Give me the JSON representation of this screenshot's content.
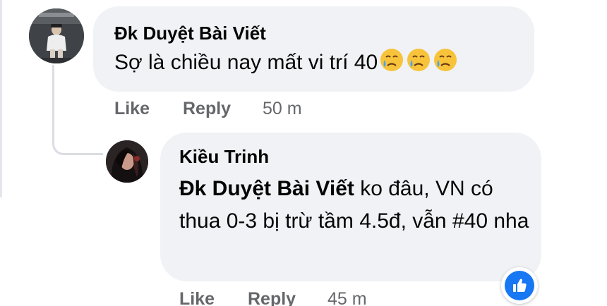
{
  "comment": {
    "author": "Đk Duyệt Bài Viết",
    "text": "Sợ là chiều nay mất vi trí 40",
    "emojis": [
      "sad-but-relieved-face",
      "sad-but-relieved-face",
      "sad-but-relieved-face"
    ],
    "actions": {
      "like": "Like",
      "reply": "Reply",
      "time": "50 m"
    }
  },
  "reply": {
    "author": "Kiều Trinh",
    "mention": "Đk Duyệt Bài Viết",
    "text": " ko đâu, VN có thua 0-3 bị trừ tầm 4.5đ, vẫn #40 nha",
    "actions": {
      "like": "Like",
      "reply": "Reply",
      "time": "45 m"
    },
    "reaction": "like-icon"
  },
  "colors": {
    "bubble": "#f0f2f5",
    "secondary_text": "#65676b",
    "accent": "#1877f2",
    "thread_line": "#dadde1"
  }
}
